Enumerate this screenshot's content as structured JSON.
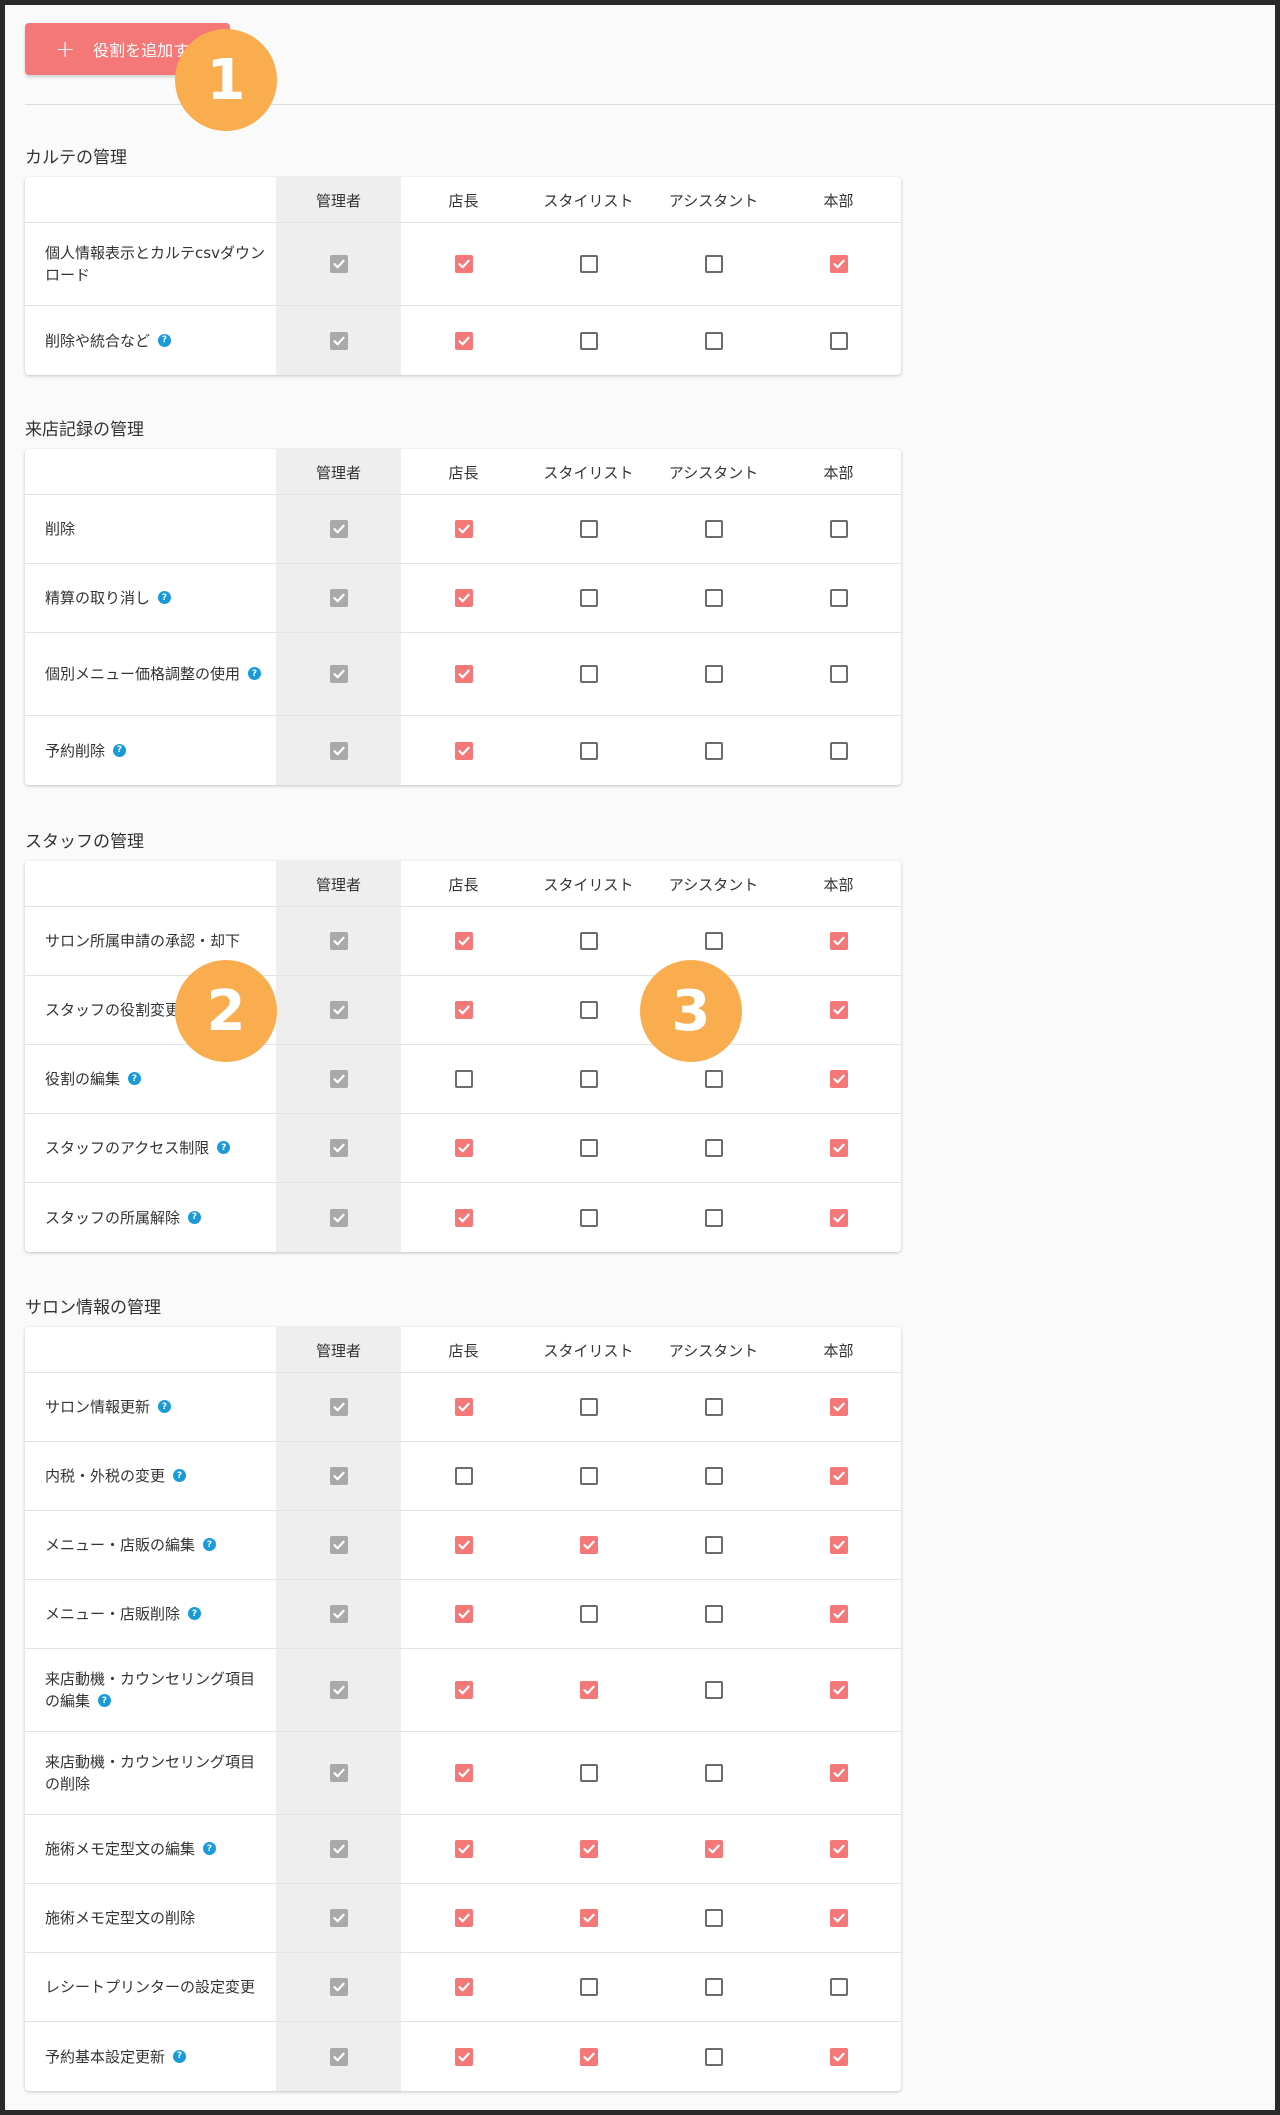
{
  "add_button": {
    "label": "役割を追加する"
  },
  "badges": [
    "1",
    "2",
    "3"
  ],
  "columns": [
    "管理者",
    "店長",
    "スタイリスト",
    "アシスタント",
    "本部"
  ],
  "sections": [
    {
      "title": "カルテの管理",
      "rows": [
        {
          "label": "個人情報表示とカルテcsvダウンロード",
          "help": false,
          "values": [
            1,
            1,
            0,
            0,
            1
          ]
        },
        {
          "label": "削除や統合など",
          "help": true,
          "values": [
            1,
            1,
            0,
            0,
            0
          ]
        }
      ]
    },
    {
      "title": "来店記録の管理",
      "rows": [
        {
          "label": "削除",
          "help": false,
          "values": [
            1,
            1,
            0,
            0,
            0
          ]
        },
        {
          "label": "精算の取り消し",
          "help": true,
          "values": [
            1,
            1,
            0,
            0,
            0
          ]
        },
        {
          "label": "個別メニュー価格調整の使用",
          "help": true,
          "values": [
            1,
            1,
            0,
            0,
            0
          ]
        },
        {
          "label": "予約削除",
          "help": true,
          "values": [
            1,
            1,
            0,
            0,
            0
          ]
        }
      ]
    },
    {
      "title": "スタッフの管理",
      "rows": [
        {
          "label": "サロン所属申請の承認・却下",
          "help": false,
          "values": [
            1,
            1,
            0,
            0,
            1
          ]
        },
        {
          "label": "スタッフの役割変更",
          "help": false,
          "values": [
            1,
            1,
            0,
            0,
            1
          ]
        },
        {
          "label": "役割の編集",
          "help": true,
          "values": [
            1,
            0,
            0,
            0,
            1
          ]
        },
        {
          "label": "スタッフのアクセス制限",
          "help": true,
          "values": [
            1,
            1,
            0,
            0,
            1
          ]
        },
        {
          "label": "スタッフの所属解除",
          "help": true,
          "values": [
            1,
            1,
            0,
            0,
            1
          ]
        }
      ]
    },
    {
      "title": "サロン情報の管理",
      "rows": [
        {
          "label": "サロン情報更新",
          "help": true,
          "values": [
            1,
            1,
            0,
            0,
            1
          ]
        },
        {
          "label": "内税・外税の変更",
          "help": true,
          "values": [
            1,
            0,
            0,
            0,
            1
          ]
        },
        {
          "label": "メニュー・店販の編集",
          "help": true,
          "values": [
            1,
            1,
            1,
            0,
            1
          ]
        },
        {
          "label": "メニュー・店販削除",
          "help": true,
          "values": [
            1,
            1,
            0,
            0,
            1
          ]
        },
        {
          "label": "来店動機・カウンセリング項目の編集",
          "help": true,
          "values": [
            1,
            1,
            1,
            0,
            1
          ]
        },
        {
          "label": "来店動機・カウンセリング項目の削除",
          "help": false,
          "values": [
            1,
            1,
            0,
            0,
            1
          ]
        },
        {
          "label": "施術メモ定型文の編集",
          "help": true,
          "values": [
            1,
            1,
            1,
            1,
            1
          ]
        },
        {
          "label": "施術メモ定型文の削除",
          "help": false,
          "values": [
            1,
            1,
            1,
            0,
            1
          ]
        },
        {
          "label": "レシートプリンターの設定変更",
          "help": false,
          "values": [
            1,
            1,
            0,
            0,
            0
          ]
        },
        {
          "label": "予約基本設定更新",
          "help": true,
          "values": [
            1,
            1,
            1,
            0,
            1
          ]
        }
      ]
    }
  ],
  "colors": {
    "accent": "#f57878",
    "badge": "#f9ad4e",
    "help": "#1a9bd7",
    "disabled": "#a9a9a9"
  }
}
